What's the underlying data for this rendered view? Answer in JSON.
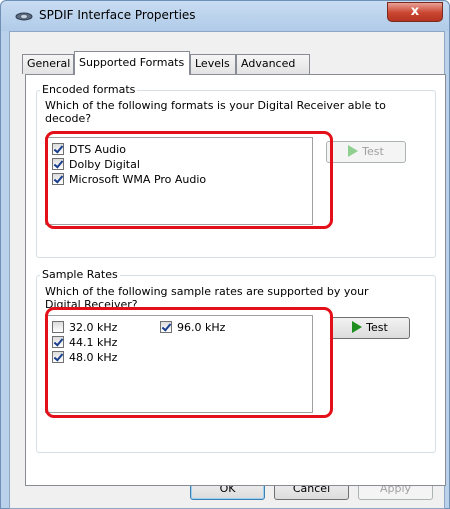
{
  "window": {
    "title": "SPDIF Interface Properties",
    "close_label": "x"
  },
  "tabs": [
    {
      "label": "General"
    },
    {
      "label": "Supported Formats"
    },
    {
      "label": "Levels"
    },
    {
      "label": "Advanced"
    }
  ],
  "encoded": {
    "legend": "Encoded formats",
    "prompt_line1": "Which of the following formats is your Digital Receiver able to",
    "prompt_line2": "decode?",
    "items": [
      {
        "label": "DTS Audio",
        "checked": true
      },
      {
        "label": "Dolby Digital",
        "checked": true
      },
      {
        "label": "Microsoft WMA Pro Audio",
        "checked": true
      }
    ],
    "test_label": "Test",
    "test_enabled": false
  },
  "rates": {
    "legend": "Sample Rates",
    "prompt_line1": "Which of the following sample rates are supported by your",
    "prompt_line2": "Digital Receiver?",
    "items": [
      {
        "label": "32.0 kHz",
        "checked": false
      },
      {
        "label": "44.1 kHz",
        "checked": true
      },
      {
        "label": "48.0 kHz",
        "checked": true
      },
      {
        "label": "96.0 kHz",
        "checked": true
      }
    ],
    "test_label": "Test",
    "test_enabled": true
  },
  "footer": {
    "ok_label": "OK",
    "cancel_label": "Cancel",
    "apply_label": "Apply"
  },
  "colors": {
    "highlight": "#e3101a",
    "window_frame": "#b9d1ea",
    "play_green": "#1e8f1e"
  }
}
